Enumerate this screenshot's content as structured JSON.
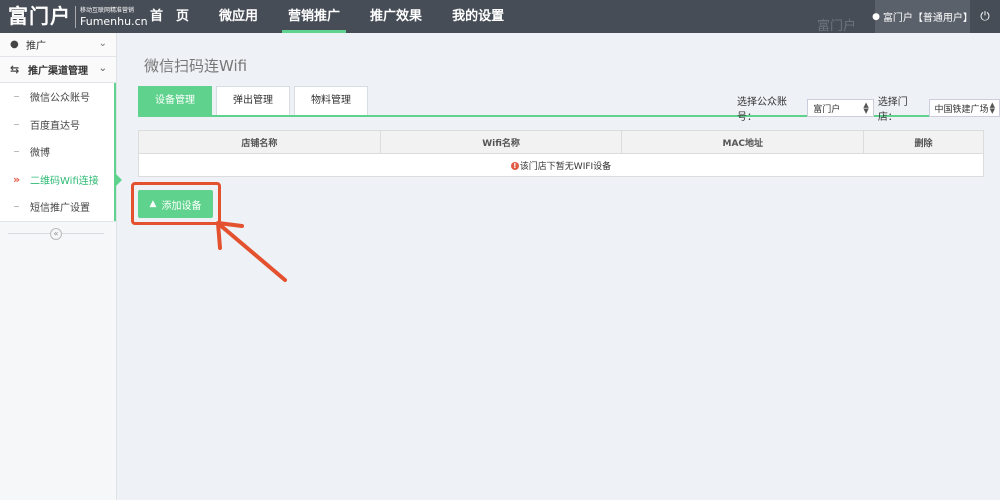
{
  "header": {
    "logo_main": "富门户",
    "logo_tagline": "移动互联网精准营销",
    "logo_domain": "Fumenhu.cn",
    "nav": [
      {
        "label": "首　页",
        "active": false
      },
      {
        "label": "微应用",
        "active": false
      },
      {
        "label": "营销推广",
        "active": true
      },
      {
        "label": "推广效果",
        "active": false
      },
      {
        "label": "我的设置",
        "active": false
      }
    ],
    "watermark": "富门户",
    "user_label": "富门户【普通用户】"
  },
  "sidebar": {
    "top_item": "推广",
    "group_label": "推广渠道管理",
    "items": [
      {
        "label": "微信公众账号",
        "active": false
      },
      {
        "label": "百度直达号",
        "active": false
      },
      {
        "label": "微博",
        "active": false
      },
      {
        "label": "二维码Wifi连接",
        "active": true
      },
      {
        "label": "短信推广设置",
        "active": false
      }
    ],
    "collapse_glyph": "«"
  },
  "main": {
    "page_title": "微信扫码连Wifi",
    "tabs": [
      {
        "label": "设备管理",
        "active": true
      },
      {
        "label": "弹出管理",
        "active": false
      },
      {
        "label": "物料管理",
        "active": false
      }
    ],
    "filters": {
      "account_label": "选择公众账号：",
      "account_value": "富门户",
      "store_label": "选择门店：",
      "store_value": "中国铁建广场"
    },
    "table": {
      "columns": [
        "店铺名称",
        "Wifi名称",
        "MAC地址",
        "删除"
      ],
      "empty_message": "该门店下暂无WIFI设备"
    },
    "add_button_label": "添加设备"
  },
  "colors": {
    "accent_green": "#5fd38d",
    "topbar": "#474d57",
    "annotation_red": "#e4512f"
  }
}
